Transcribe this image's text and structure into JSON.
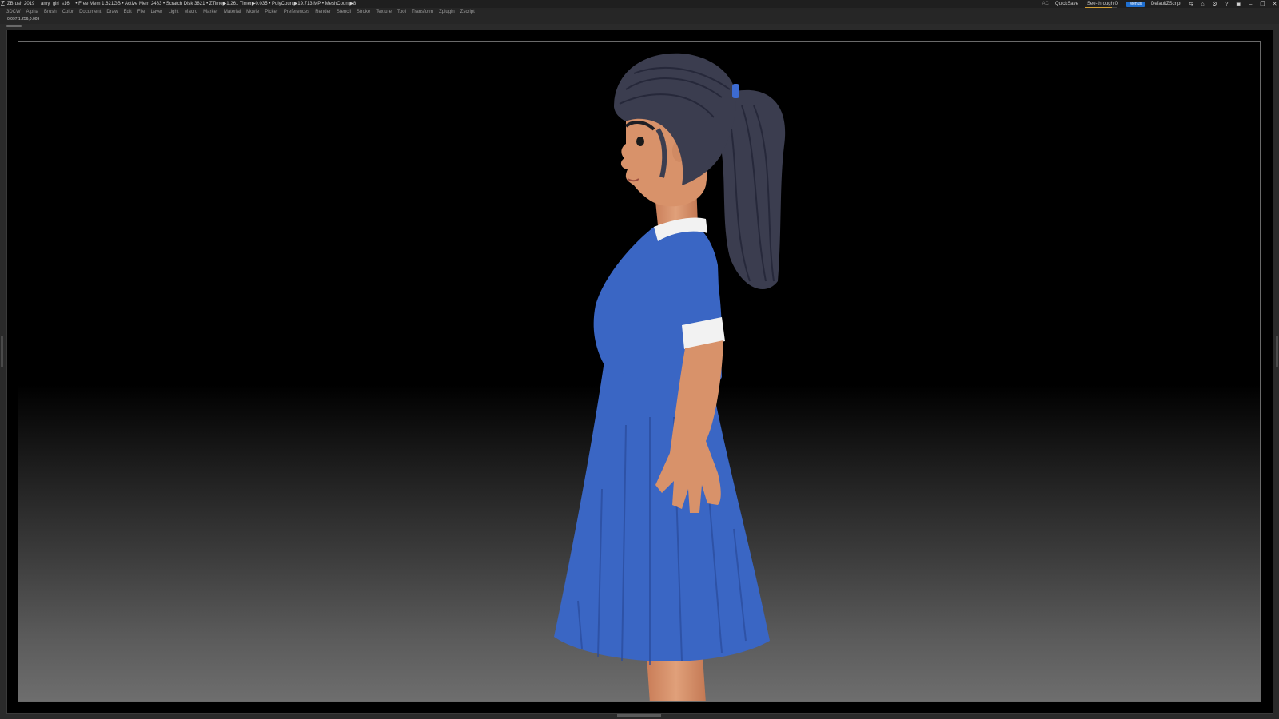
{
  "titlebar": {
    "app_name": "ZBrush 2019",
    "file_name": "amy_girl_s16",
    "stats": "• Free Mem 1.621GB • Active Mem 2483 • Scratch Disk 3821 • ZTime▶1.261 Timer▶0.035 • PolyCount▶19.713 MP • MeshCount▶8",
    "ac_label": "AC",
    "quicksave_label": "QuickSave",
    "see_through_label": "See-through",
    "see_through_value": "0",
    "see_through_level": 0.85,
    "menus_label": "Menus",
    "script_label": "DefaultZScript"
  },
  "menubar": {
    "items": [
      "3DCW",
      "Alpha",
      "Brush",
      "Color",
      "Document",
      "Draw",
      "Edit",
      "File",
      "Layer",
      "Light",
      "Macro",
      "Marker",
      "Material",
      "Movie",
      "Picker",
      "Preferences",
      "Render",
      "Stencil",
      "Stroke",
      "Texture",
      "Tool",
      "Transform",
      "Zplugin",
      "Zscript"
    ]
  },
  "info": {
    "coords": "0.097,1.256,0.009"
  },
  "colors": {
    "dress": "#3a66c4",
    "collar": "#f2f2f2",
    "skin": "#d8926a",
    "hair": "#3b3d4f",
    "hair_tie": "#3d6bd1",
    "accent": "#1f6fd0"
  }
}
